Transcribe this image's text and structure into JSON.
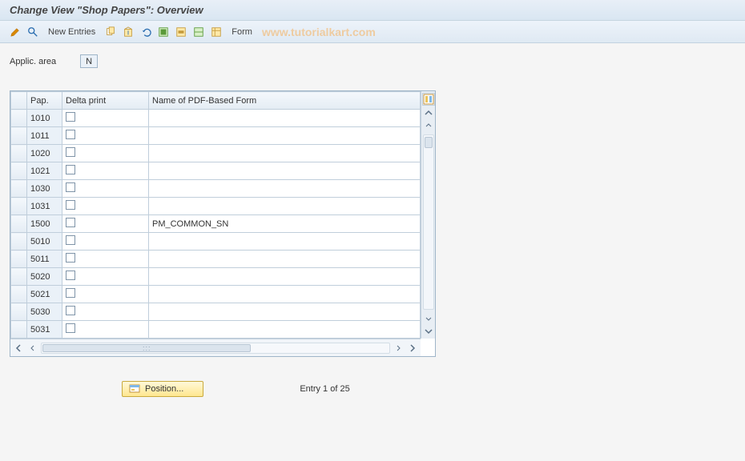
{
  "title": "Change View \"Shop Papers\": Overview",
  "toolbar": {
    "new_entries_label": "New Entries",
    "form_label": "Form"
  },
  "watermark": "www.tutorialkart.com",
  "field": {
    "label": "Applic. area",
    "value": "N"
  },
  "columns": {
    "pap": "Pap.",
    "delta": "Delta print",
    "pdf": "Name of PDF-Based Form"
  },
  "rows": [
    {
      "pap": "1010",
      "delta": false,
      "pdf": ""
    },
    {
      "pap": "1011",
      "delta": false,
      "pdf": ""
    },
    {
      "pap": "1020",
      "delta": false,
      "pdf": ""
    },
    {
      "pap": "1021",
      "delta": false,
      "pdf": ""
    },
    {
      "pap": "1030",
      "delta": false,
      "pdf": ""
    },
    {
      "pap": "1031",
      "delta": false,
      "pdf": ""
    },
    {
      "pap": "1500",
      "delta": false,
      "pdf": "PM_COMMON_SN"
    },
    {
      "pap": "5010",
      "delta": false,
      "pdf": ""
    },
    {
      "pap": "5011",
      "delta": false,
      "pdf": ""
    },
    {
      "pap": "5020",
      "delta": false,
      "pdf": ""
    },
    {
      "pap": "5021",
      "delta": false,
      "pdf": ""
    },
    {
      "pap": "5030",
      "delta": false,
      "pdf": ""
    },
    {
      "pap": "5031",
      "delta": false,
      "pdf": ""
    }
  ],
  "footer": {
    "position_label": "Position...",
    "entry_text": "Entry 1 of 25"
  }
}
